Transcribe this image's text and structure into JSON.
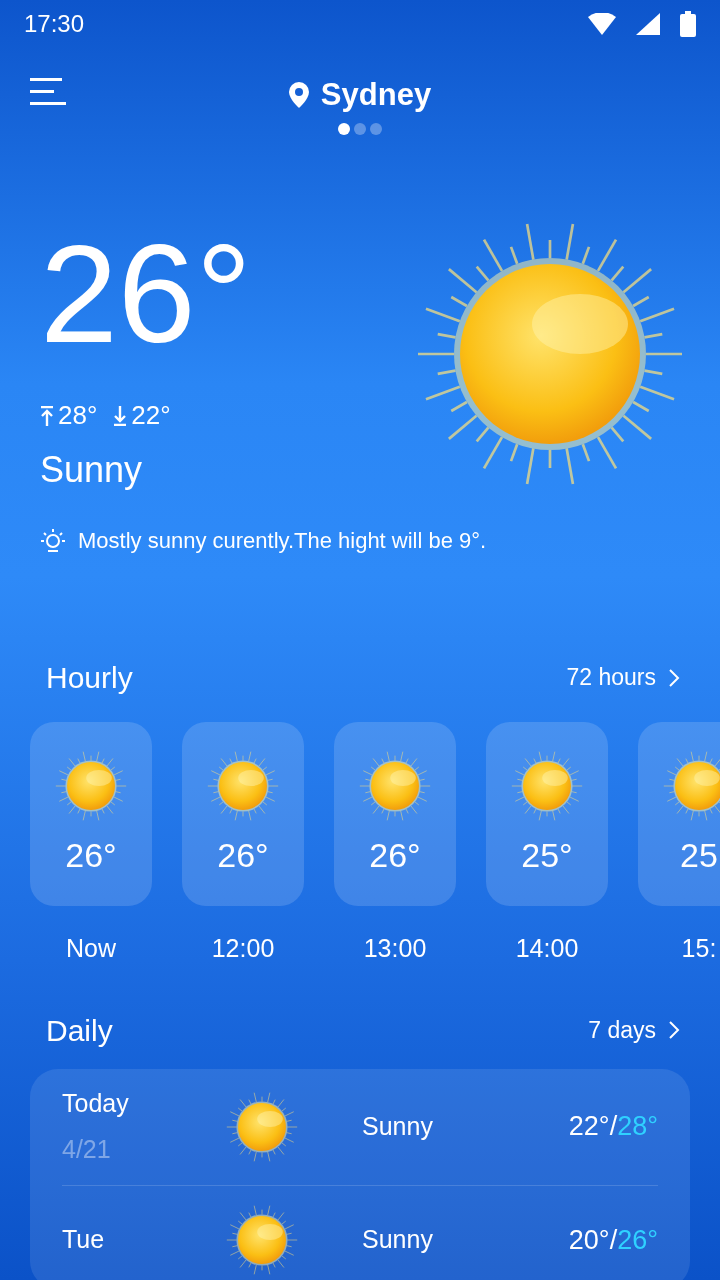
{
  "status_bar": {
    "time": "17:30"
  },
  "header": {
    "location": "Sydney",
    "pages": [
      {
        "selected": true
      },
      {
        "selected": false
      },
      {
        "selected": false
      }
    ]
  },
  "current": {
    "temperature": "26°",
    "high": "28°",
    "low": "22°",
    "condition": "Sunny",
    "summary": "Mostly sunny curently.The hight will be 9°."
  },
  "hourly": {
    "title": "Hourly",
    "link": "72 hours",
    "items": [
      {
        "temperature": "26°",
        "time": "Now"
      },
      {
        "temperature": "26°",
        "time": "12:00"
      },
      {
        "temperature": "26°",
        "time": "13:00"
      },
      {
        "temperature": "25°",
        "time": "14:00"
      },
      {
        "temperature": "25",
        "time": "15:"
      }
    ]
  },
  "daily": {
    "title": "Daily",
    "link": "7 days",
    "items": [
      {
        "day": "Today",
        "date": "4/21",
        "condition": "Sunny",
        "low": "22°",
        "separator": "/",
        "high": "28°"
      },
      {
        "day": "Tue",
        "condition": "Sunny",
        "low": "20°",
        "separator": "/",
        "high": "26°"
      }
    ]
  }
}
